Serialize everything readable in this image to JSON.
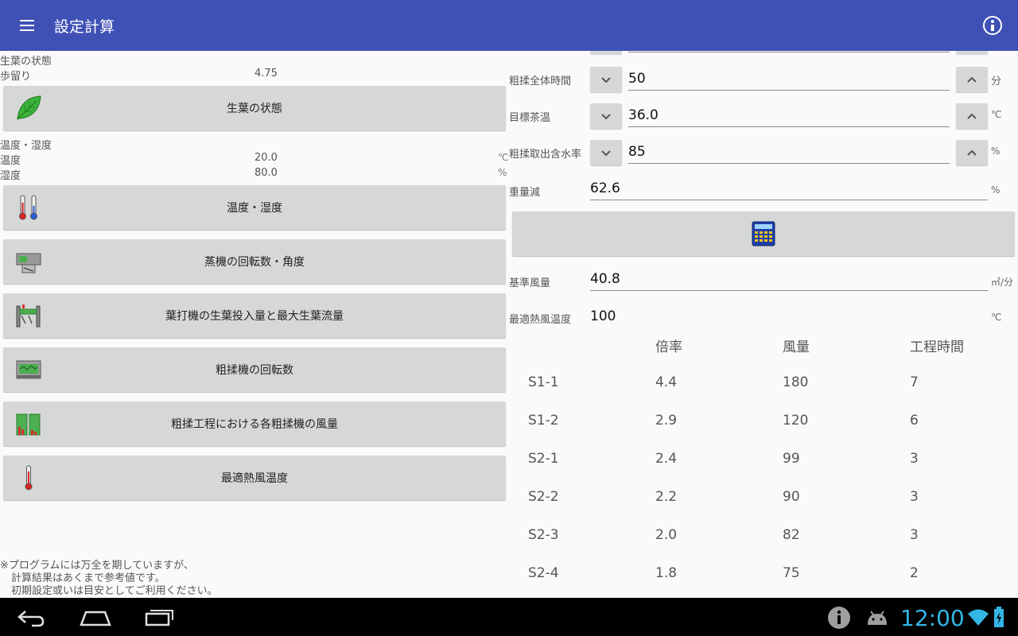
{
  "app": {
    "title": "設定計算"
  },
  "left": {
    "leaf_state": {
      "heading": "生葉の状態",
      "yield_label": "歩留り",
      "yield_value": "4.75"
    },
    "temp_humidity": {
      "heading": "温度・湿度",
      "temp_label": "温度",
      "temp_value": "20.0",
      "temp_unit": "℃",
      "humidity_label": "湿度",
      "humidity_value": "80.0",
      "humidity_unit": "%"
    },
    "menu_items": [
      {
        "label": "生葉の状態",
        "icon": "leaf-icon"
      },
      {
        "label": "温度・湿度",
        "icon": "thermometer-pair-icon"
      },
      {
        "label": "蒸機の回転数・角度",
        "icon": "steamer-machine-icon"
      },
      {
        "label": "葉打機の生葉投入量と最大生葉流量",
        "icon": "leaf-beater-icon"
      },
      {
        "label": "粗揉機の回転数",
        "icon": "rolling-machine-icon"
      },
      {
        "label": "粗揉工程における各粗揉機の風量",
        "icon": "airflow-chart-icon"
      },
      {
        "label": "最適熱風温度",
        "icon": "thermometer-icon"
      }
    ],
    "disclaimer": [
      "※プログラムには万全を期していますが、",
      "計算結果はあくまで参考値です。",
      "初期設定或いは目安としてご利用ください。"
    ]
  },
  "right": {
    "total_time": {
      "label": "粗揉全体時間",
      "value": "50",
      "unit": "分"
    },
    "target_temp": {
      "label": "目標茶温",
      "value": "36.0",
      "unit": "℃"
    },
    "moisture": {
      "label": "粗揉取出含水率",
      "value": "85",
      "unit": "%"
    },
    "weight_loss": {
      "label": "重量減",
      "value": "62.6",
      "unit": "%"
    },
    "base_airflow": {
      "label": "基準風量",
      "value": "40.8",
      "unit": "㎥/分"
    },
    "hot_air_temp": {
      "label": "最適熱風温度",
      "value": "100",
      "unit": "℃"
    },
    "table": {
      "headers": [
        "倍率",
        "風量",
        "工程時間"
      ],
      "rows": [
        {
          "stage": "S1-1",
          "ratio": "4.4",
          "airflow": "180",
          "time": "7"
        },
        {
          "stage": "S1-2",
          "ratio": "2.9",
          "airflow": "120",
          "time": "6"
        },
        {
          "stage": "S2-1",
          "ratio": "2.4",
          "airflow": "99",
          "time": "3"
        },
        {
          "stage": "S2-2",
          "ratio": "2.2",
          "airflow": "90",
          "time": "3"
        },
        {
          "stage": "S2-3",
          "ratio": "2.0",
          "airflow": "82",
          "time": "3"
        },
        {
          "stage": "S2-4",
          "ratio": "1.8",
          "airflow": "75",
          "time": "2"
        }
      ]
    }
  },
  "system": {
    "clock": "12:00"
  },
  "colors": {
    "appbar": "#3f51b5",
    "button": "#d6d7d7",
    "clock": "#33b5e5"
  }
}
